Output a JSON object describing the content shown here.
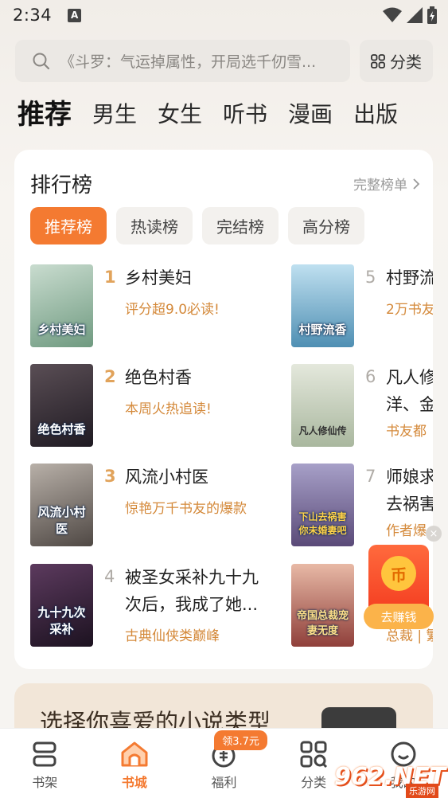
{
  "status": {
    "time": "2:34",
    "app_badge": "A"
  },
  "search": {
    "placeholder": "《斗罗：气运掉属性，开局选千仞雪..."
  },
  "category_button": {
    "label": "分类"
  },
  "tabs": [
    "推荐",
    "男生",
    "女生",
    "听书",
    "漫画",
    "出版"
  ],
  "ranking": {
    "title": "排行榜",
    "more": "完整榜单",
    "tabs": [
      "推荐榜",
      "热读榜",
      "完结榜",
      "高分榜"
    ],
    "books": [
      {
        "rank": "1",
        "title": "乡村美妇",
        "desc": "评分超9.0必读!",
        "cover_text": "乡村美妇",
        "cover_color": "#8fb39a"
      },
      {
        "rank": "2",
        "title": "绝色村香",
        "desc": "本周火热追读!",
        "cover_text": "绝色村香",
        "cover_color": "#3b3440"
      },
      {
        "rank": "3",
        "title": "风流小村医",
        "desc": "惊艳万千书友的爆款",
        "cover_text": "风流小村医",
        "cover_color": "#7a6f69"
      },
      {
        "rank": "4",
        "title": "被圣女采补九十九次后，我成了她...",
        "desc": "古典仙侠类巅峰",
        "cover_text": "九十九次采补",
        "cover_color": "#3a2a3c"
      },
      {
        "rank": "5",
        "title": "村野流",
        "desc": "2万书友",
        "cover_text": "村野流香",
        "cover_color": "#6aa7c9"
      },
      {
        "rank": "6",
        "title": "凡人修洋、金",
        "desc": "书友都",
        "cover_text": "凡人修仙传",
        "cover_color": "#c9d3c0"
      },
      {
        "rank": "7",
        "title": "师娘求去祸害",
        "desc": "作者爆",
        "cover_text": "下山去祸害你未婚妻吧",
        "cover_color": "#7f6a9c"
      },
      {
        "rank": "8",
        "title": "",
        "desc": "总裁 | 繁",
        "cover_text": "帝国总裁宠妻无度",
        "cover_color": "#c4776b"
      }
    ]
  },
  "genre_card": {
    "text": "选择你喜爱的小说类型"
  },
  "floating": {
    "button": "去赚钱",
    "coin": "币",
    "close": "×"
  },
  "bottom_nav": [
    {
      "label": "书架",
      "icon": "bookshelf-icon"
    },
    {
      "label": "书城",
      "icon": "home-icon",
      "active": true
    },
    {
      "label": "福利",
      "icon": "gift-icon",
      "badge": "领3.7元"
    },
    {
      "label": "分类",
      "icon": "grid-icon"
    },
    {
      "label": "我的",
      "icon": "profile-icon"
    }
  ],
  "watermark": {
    "logo": "962.NET",
    "sub": "乐游网"
  },
  "colors": {
    "accent": "#f47a31",
    "rank_gold": "#e1a35b"
  }
}
